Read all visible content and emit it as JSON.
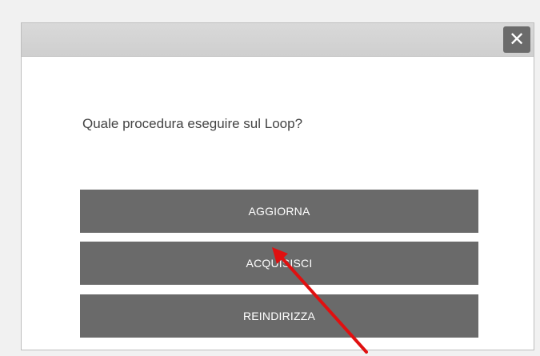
{
  "dialog": {
    "close_glyph": "✕",
    "question": "Quale procedura eseguire sul Loop?",
    "buttons": [
      {
        "label": "AGGIORNA"
      },
      {
        "label": "ACQUISISCI"
      },
      {
        "label": "REINDIRIZZA"
      }
    ]
  },
  "colors": {
    "button_bg": "#6a6a6a",
    "button_text": "#ffffff",
    "titlebar": "#d4d4d4",
    "annotation_arrow": "#e01010"
  },
  "icons": {
    "close": "close-icon",
    "annotation": "red-arrow-pointer"
  }
}
